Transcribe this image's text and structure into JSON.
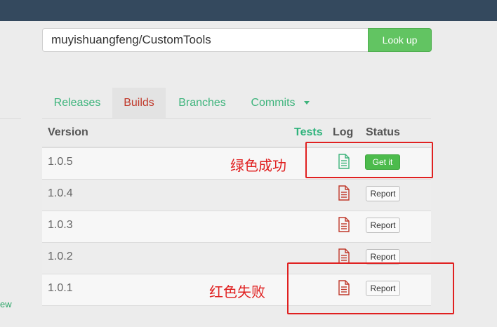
{
  "search": {
    "value": "muyishuangfeng/CustomTools",
    "button_label": "Look up"
  },
  "left_link": "ew",
  "tabs": [
    {
      "label": "Releases",
      "active": false
    },
    {
      "label": "Builds",
      "active": true
    },
    {
      "label": "Branches",
      "active": false
    },
    {
      "label": "Commits",
      "active": false,
      "has_dropdown": true
    }
  ],
  "table": {
    "headers": {
      "version": "Version",
      "tests": "Tests",
      "log": "Log",
      "status": "Status"
    },
    "rows": [
      {
        "version": "1.0.5",
        "log_icon": "file-text-icon",
        "log_color": "#3eb47c",
        "status": "Get it",
        "status_type": "success"
      },
      {
        "version": "1.0.4",
        "log_icon": "file-text-icon",
        "log_color": "#c0392b",
        "status": "Report",
        "status_type": "failure"
      },
      {
        "version": "1.0.3",
        "log_icon": "file-text-icon",
        "log_color": "#c0392b",
        "status": "Report",
        "status_type": "failure"
      },
      {
        "version": "1.0.2",
        "log_icon": "file-text-icon",
        "log_color": "#c0392b",
        "status": "Report",
        "status_type": "failure"
      },
      {
        "version": "1.0.1",
        "log_icon": "file-text-icon",
        "log_color": "#c0392b",
        "status": "Report",
        "status_type": "failure"
      }
    ]
  },
  "annotations": {
    "success_label": "绿色成功",
    "failure_label": "红色失败",
    "color": "#e02020"
  },
  "colors": {
    "header_bar": "#34495e",
    "accent_green": "#3eb47c",
    "active_tab_red": "#c0392b",
    "button_green": "#62c462"
  }
}
